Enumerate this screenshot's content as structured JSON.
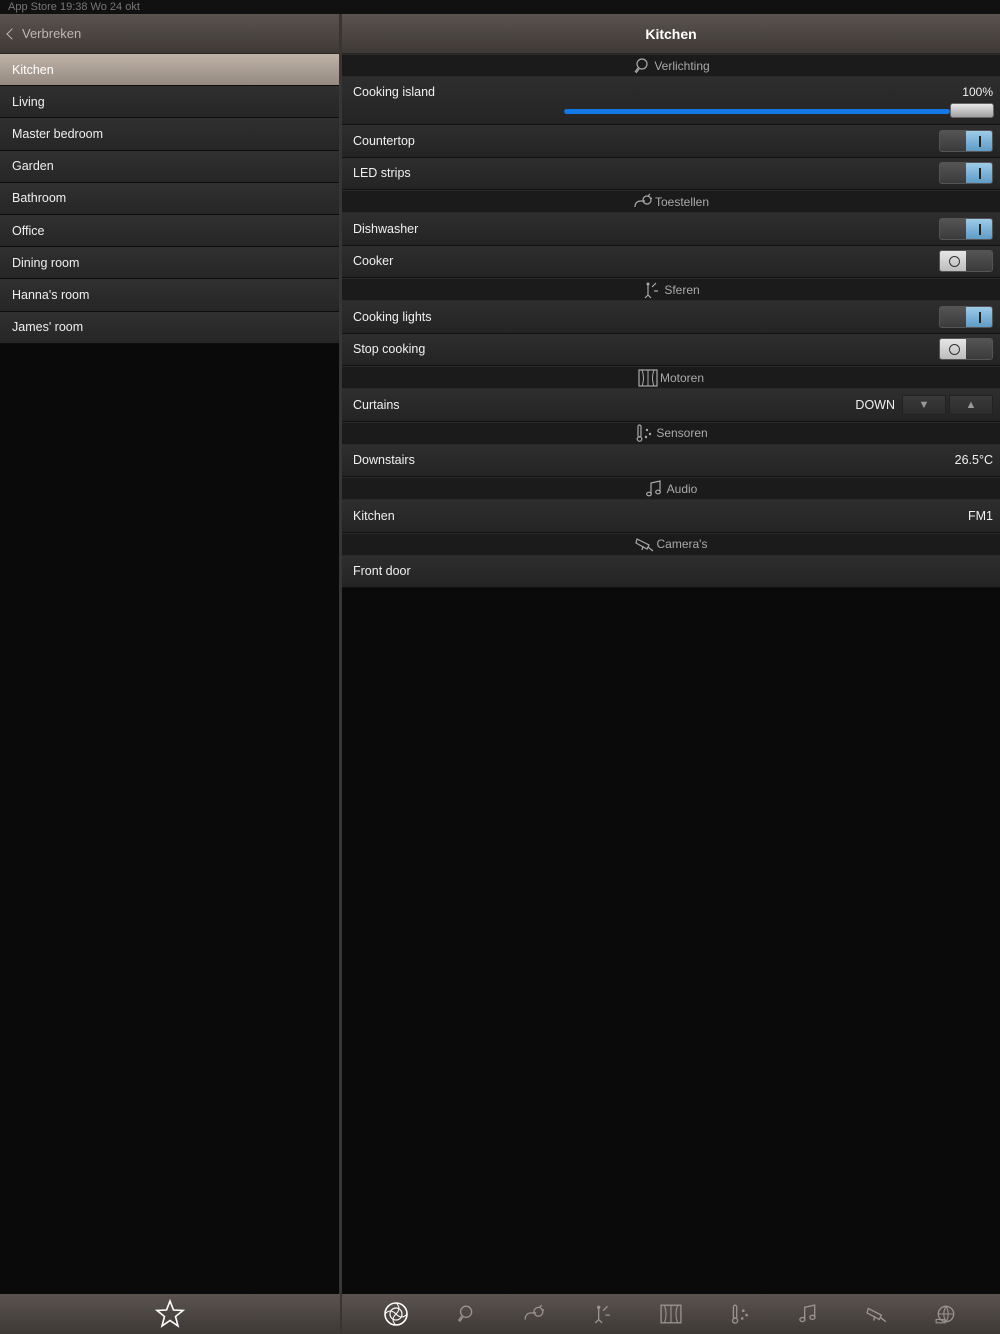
{
  "statusbar": {
    "left": "App Store  19:38  Wo 24 okt",
    "right": ""
  },
  "sidebar": {
    "back_label": "Verbreken",
    "items": [
      {
        "label": "Kitchen",
        "active": true
      },
      {
        "label": "Living"
      },
      {
        "label": "Master bedroom"
      },
      {
        "label": "Garden"
      },
      {
        "label": "Bathroom"
      },
      {
        "label": "Office"
      },
      {
        "label": "Dining room"
      },
      {
        "label": "Hanna's room"
      },
      {
        "label": "James' room"
      }
    ]
  },
  "main": {
    "title": "Kitchen",
    "sections": {
      "lighting": {
        "title": "Verlichting",
        "icon": "bulb-icon"
      },
      "appliances": {
        "title": "Toestellen",
        "icon": "plug-icon"
      },
      "moods": {
        "title": "Sferen",
        "icon": "mood-icon"
      },
      "motors": {
        "title": "Motoren",
        "icon": "curtain-icon"
      },
      "sensors": {
        "title": "Sensoren",
        "icon": "thermometer-icon"
      },
      "audio": {
        "title": "Audio",
        "icon": "music-note-icon"
      },
      "cameras": {
        "title": "Camera's",
        "icon": "camera-icon"
      }
    },
    "cooking_island": {
      "label": "Cooking island",
      "value": "100%",
      "level": 1.0
    },
    "countertop": {
      "label": "Countertop",
      "state": "on"
    },
    "led_strips": {
      "label": "LED strips",
      "state": "on"
    },
    "dishwasher": {
      "label": "Dishwasher",
      "state": "on"
    },
    "cooker": {
      "label": "Cooker",
      "state": "off"
    },
    "cooking_lights": {
      "label": "Cooking lights",
      "state": "on"
    },
    "stop_cooking": {
      "label": "Stop cooking",
      "state": "off"
    },
    "curtains": {
      "label": "Curtains",
      "state": "DOWN",
      "down_symbol": "▼",
      "up_symbol": "▲"
    },
    "downstairs": {
      "label": "Downstairs",
      "value": "26.5°C"
    },
    "audio_kitchen": {
      "label": "Kitchen",
      "value": "FM1"
    },
    "front_door": {
      "label": "Front door"
    }
  },
  "bottombar": {
    "favorites_icon": "star-icon",
    "tabs": [
      "rooms-icon",
      "bulb-icon",
      "plug-icon",
      "mood-icon",
      "curtain-icon",
      "thermometer-icon",
      "music-note-icon",
      "camera-icon",
      "globe-icon"
    ]
  },
  "colors": {
    "accent": "#1378e6",
    "active_room": "#b0a59b",
    "header": "#4a4441"
  }
}
